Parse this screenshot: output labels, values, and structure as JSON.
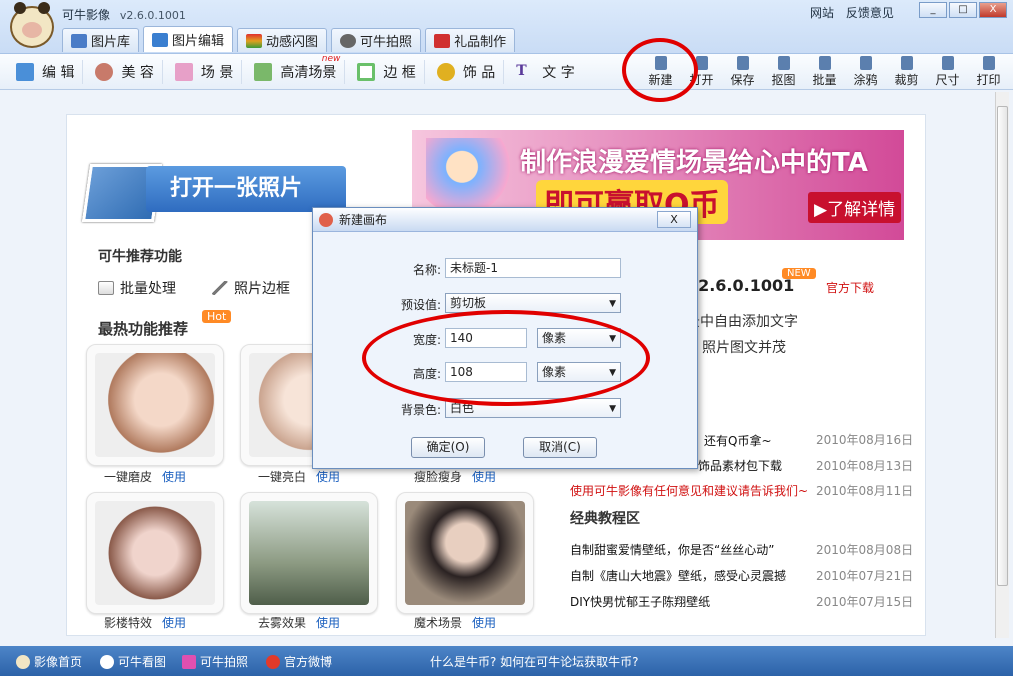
{
  "app": {
    "title": "可牛影像",
    "version": "v2.6.0.1001"
  },
  "top_links": [
    "网站",
    "反馈意见"
  ],
  "window_buttons": {
    "min": "_",
    "max": "□",
    "close": "X"
  },
  "tabs": [
    {
      "label": "图片库",
      "icon": "gallery-icon",
      "color": "#4a7cc7"
    },
    {
      "label": "图片编辑",
      "icon": "photo-edit-icon",
      "color": "#3a7fd0"
    },
    {
      "label": "动感闪图",
      "icon": "flash-gif-icon",
      "color": "#e0a020"
    },
    {
      "label": "可牛拍照",
      "icon": "webcam-icon",
      "color": "#666666"
    },
    {
      "label": "礼品制作",
      "icon": "gift-icon",
      "color": "#d03030"
    }
  ],
  "left_tools": [
    {
      "label": "编 辑",
      "icon": "edit-icon",
      "color": "#4a8fd8"
    },
    {
      "label": "美 容",
      "icon": "beauty-icon",
      "color": "#c87a6a"
    },
    {
      "label": "场 景",
      "icon": "scene-icon",
      "color": "#e7a0c8"
    },
    {
      "label": "高清场景",
      "icon": "hd-scene-icon",
      "color": "#7ab86a"
    },
    {
      "label": "边 框",
      "icon": "frame-icon",
      "color": "#6ac06a"
    },
    {
      "label": "饰 品",
      "icon": "accessory-icon",
      "color": "#e0b020"
    },
    {
      "label": "文 字",
      "icon": "text-icon",
      "color": "#5a3a9a"
    }
  ],
  "hd_new_badge": "new",
  "right_tools": [
    "新建",
    "打开",
    "保存",
    "抠图",
    "批量",
    "涂鸦",
    "裁剪",
    "尺寸",
    "打印"
  ],
  "home": {
    "open_photo": "打开一张照片",
    "recommend_title": "可牛推荐功能",
    "recommend_items": [
      {
        "label": "批量处理",
        "icon": "batch-icon"
      },
      {
        "label": "照片边框",
        "icon": "photo-frame-icon"
      }
    ],
    "hot_title": "最热功能推荐",
    "hot_badge": "Hot",
    "thumbnails": [
      {
        "caption": "一键磨皮",
        "action": "使用",
        "colors": [
          "#f4d8c8",
          "#b07a5e"
        ]
      },
      {
        "caption": "一键亮白",
        "action": "使用",
        "colors": [
          "#f7e4d8",
          "#caa48f"
        ]
      },
      {
        "caption": "瘦脸瘦身",
        "action": "使用",
        "colors": [
          "#efe6d4",
          "#9a8672"
        ]
      },
      {
        "caption": "影楼特效",
        "action": "使用",
        "colors": [
          "#f0d4cc",
          "#8a5a4a"
        ]
      },
      {
        "caption": "去雾效果",
        "action": "使用",
        "colors": [
          "#c9d6c2",
          "#5f6e5a"
        ]
      },
      {
        "caption": "魔术场景",
        "action": "使用",
        "colors": [
          "#d8c6b8",
          "#3a2e2e"
        ]
      }
    ]
  },
  "banner": {
    "line1": "制作浪漫爱情场景给心中的TA",
    "line2": "即可赢取Q币",
    "cta": "▶了解详情"
  },
  "version_info": {
    "text": ".2.6.0.1001",
    "badge": "NEW",
    "download": "官方下载"
  },
  "version_desc": [
    "景中自由添加文字",
    "照片图文并茂"
  ],
  "news": [
    {
      "title": "还有Q币拿~",
      "date": "2010年08月16日",
      "highlight": false
    },
    {
      "title": "饰品素材包下载",
      "date": "2010年08月13日",
      "highlight": false
    },
    {
      "title": "使用可牛影像有任何意见和建议请告诉我们~",
      "date": "2010年08月11日",
      "highlight": true
    }
  ],
  "tutorial_title": "经典教程区",
  "tutorials": [
    {
      "title": "自制甜蜜爱情壁纸，你是否“丝丝心动”",
      "date": "2010年08月08日"
    },
    {
      "title": "自制《唐山大地震》壁纸，感受心灵震撼",
      "date": "2010年07月21日"
    },
    {
      "title": "DIY快男忧郁王子陈翔壁纸",
      "date": "2010年07月15日"
    }
  ],
  "status_bar": [
    {
      "label": "影像首页",
      "icon": "home-icon"
    },
    {
      "label": "可牛看图",
      "icon": "viewer-icon"
    },
    {
      "label": "可牛拍照",
      "icon": "camera-icon"
    },
    {
      "label": "官方微博",
      "icon": "weibo-icon"
    }
  ],
  "status_center": "什么是牛币? 如何在可牛论坛获取牛币?",
  "dialog": {
    "title": "新建画布",
    "close": "X",
    "name_label": "名称:",
    "name_value": "未标题-1",
    "preset_label": "预设值:",
    "preset_value": "剪切板",
    "width_label": "宽度:",
    "width_value": "140",
    "width_unit": "像素",
    "height_label": "高度:",
    "height_value": "108",
    "height_unit": "像素",
    "bg_label": "背景色:",
    "bg_value": "白色",
    "ok": "确定(O)",
    "cancel": "取消(C)"
  }
}
